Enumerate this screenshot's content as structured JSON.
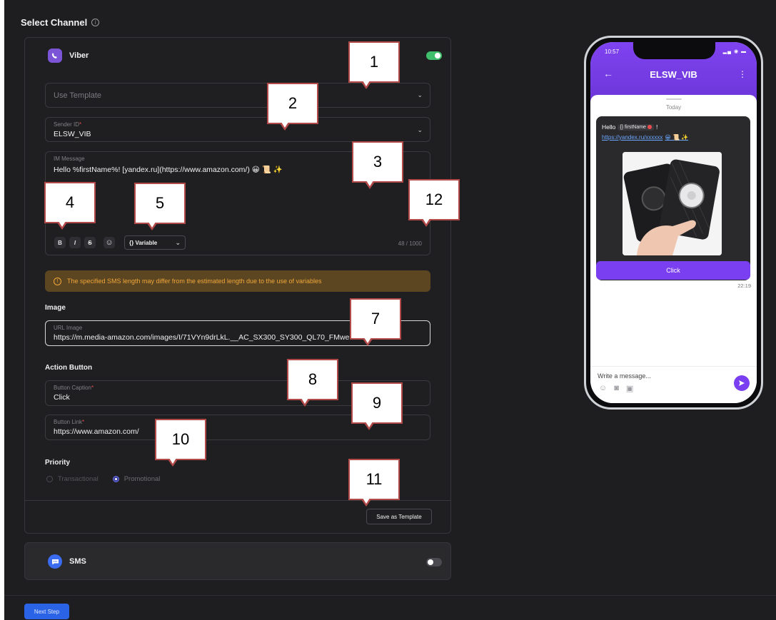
{
  "header": {
    "title": "Select Channel",
    "info_icon": "info-icon"
  },
  "viber": {
    "name": "Viber",
    "enabled": true,
    "template_placeholder": "Use Template",
    "sender_id": {
      "label": "Sender ID",
      "required_mark": "*",
      "value": "ELSW_VIB"
    },
    "message": {
      "label": "IM Message",
      "value": "Hello %firstName%! [yandex.ru](https://www.amazon.com/) 😀 📜 ✨",
      "toolbar": {
        "bold": "B",
        "italic": "I",
        "strike": "S",
        "variable_label": "{} Variable"
      },
      "counter": "48 / 1000"
    },
    "warning": "The specified SMS length may differ from the estimated length due to the use of variables",
    "image": {
      "section_title": "Image",
      "url_label": "URL Image",
      "url_value": "https://m.media-amazon.com/images/I/71VYn9drLkL.__AC_SX300_SY300_QL70_FMwebp_.jpg"
    },
    "action_button": {
      "section_title": "Action Button",
      "caption_label": "Button Caption",
      "caption_value": "Click",
      "link_label": "Button Link",
      "link_value": "https://www.amazon.com/",
      "required_mark": "*"
    },
    "priority": {
      "section_title": "Priority",
      "options": [
        "Transactional",
        "Promotional"
      ],
      "selected": "Promotional"
    },
    "save_template_label": "Save as Template"
  },
  "sms": {
    "name": "SMS",
    "enabled": false
  },
  "next_step_label": "Next Step",
  "callouts": [
    "1",
    "2",
    "3",
    "4",
    "5",
    "7",
    "8",
    "9",
    "10",
    "11",
    "12"
  ],
  "phone": {
    "time": "10:57",
    "contact": "ELSW_VIB",
    "day_label": "Today",
    "greeting": "Hello",
    "variable_chip": "{} firstName",
    "exclaim": "!",
    "link_text": "https://yandex.ru/xxxxxx",
    "emojis": "😀 📜 ✨",
    "button_label": "Click",
    "message_time": "22:19",
    "composer_placeholder": "Write a message..."
  },
  "colors": {
    "accent_purple": "#7a3ff0",
    "toggle_on": "#3fbf6b",
    "warning_text": "#f0a63a",
    "next_button": "#2b63e6"
  }
}
